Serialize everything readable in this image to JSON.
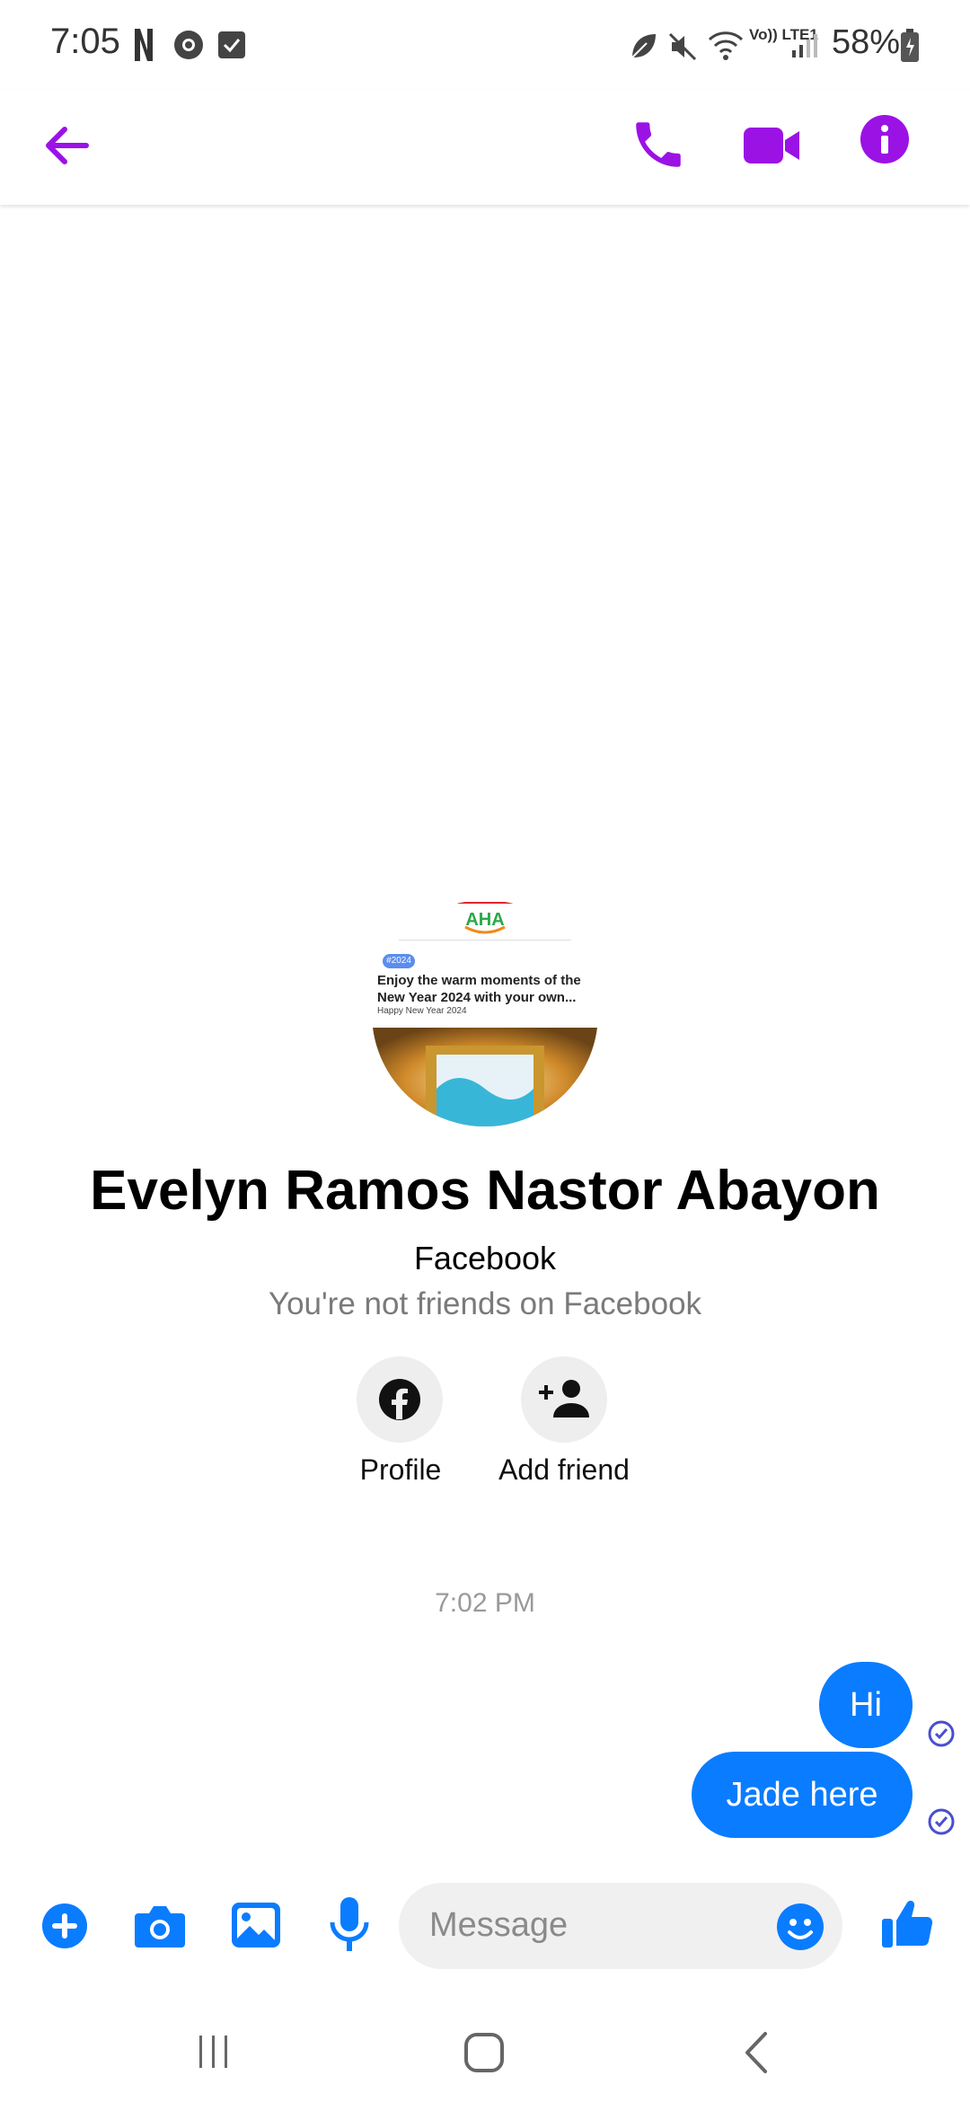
{
  "status_bar": {
    "time": "7:05",
    "battery": "58%",
    "network": "Vo)) LTE1"
  },
  "header": {
    "accent_color": "#9b12e5"
  },
  "profile": {
    "name": "Evelyn Ramos Nastor Abayon",
    "subtitle": "Facebook",
    "note": "You're not friends on Facebook",
    "image": {
      "badge": "#2024",
      "headline": "Enjoy the warm moments of the New Year 2024 with your own...",
      "caption": "Happy New Year 2024"
    },
    "actions": [
      {
        "label": "Profile",
        "icon": "facebook-icon"
      },
      {
        "label": "Add friend",
        "icon": "add-friend-icon"
      }
    ]
  },
  "chat": {
    "timestamp": "7:02 PM",
    "messages": [
      {
        "text": "Hi",
        "status": "delivered"
      },
      {
        "text": "Jade here",
        "status": "delivered"
      }
    ],
    "bubble_color": "#0a7cff"
  },
  "composer": {
    "placeholder": "Message",
    "tool_color": "#0a7cff"
  }
}
